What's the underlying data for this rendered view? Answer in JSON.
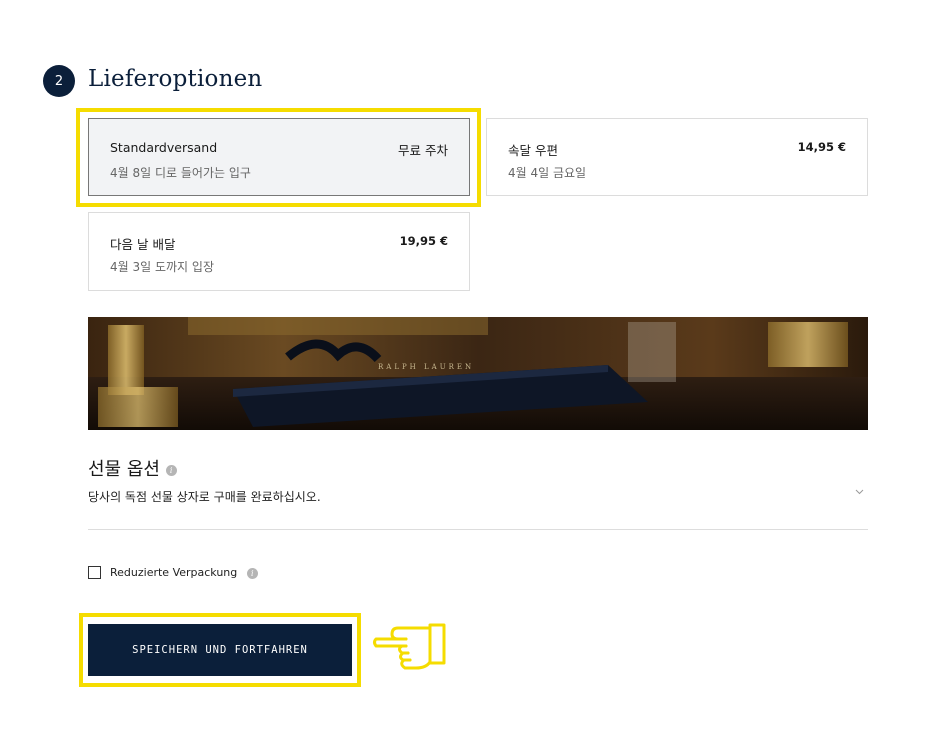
{
  "section": {
    "step_number": "2",
    "title": "Lieferoptionen"
  },
  "shipping_options": [
    {
      "name": "Standardversand",
      "price": "무료 주차",
      "detail": "4월 8일 디로 들어가는 입구",
      "selected": true
    },
    {
      "name": "속달 우편",
      "price": "14,95 €",
      "detail": "4월 4일 금요일",
      "selected": false
    },
    {
      "name": "다음 날 배달",
      "price": "19,95 €",
      "detail": "4월 3일 도까지 입장",
      "selected": false
    }
  ],
  "banner": {
    "brand_text": "RALPH LAUREN"
  },
  "gift_options": {
    "title": "선물 옵션",
    "info_icon": "info-icon",
    "description": "당사의 독점 선물 상자로 구매를 완료하십시오.",
    "expand_icon": "chevron-down-icon"
  },
  "reduced_packaging": {
    "label": "Reduzierte Verpackung",
    "checked": false
  },
  "save_button": {
    "label": "SPEICHERN UND FORTFAHREN"
  },
  "colors": {
    "navy": "#0b1f3a",
    "highlight": "#f5dc00"
  }
}
